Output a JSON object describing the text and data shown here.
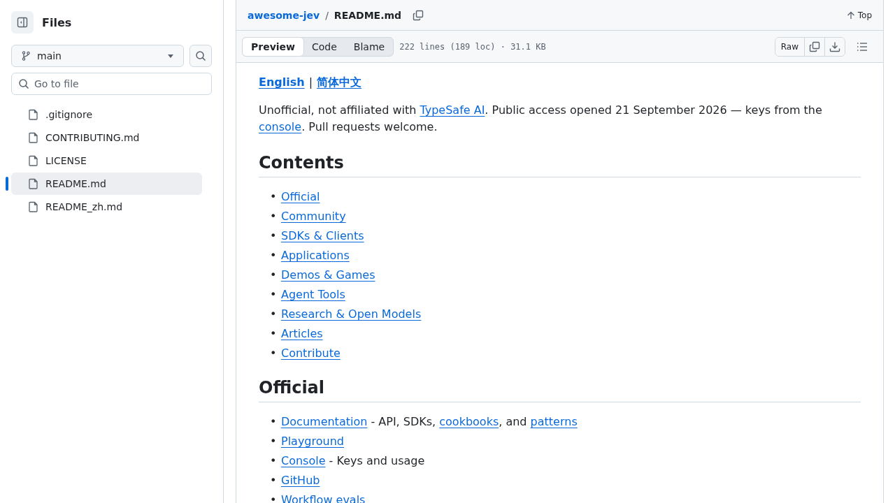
{
  "sidebar": {
    "title": "Files",
    "branch": "main",
    "search": {
      "placeholder": "Go to file"
    },
    "files": [
      {
        "name": ".gitignore",
        "selected": false
      },
      {
        "name": "CONTRIBUTING.md",
        "selected": false
      },
      {
        "name": "LICENSE",
        "selected": false
      },
      {
        "name": "README.md",
        "selected": true
      },
      {
        "name": "README_zh.md",
        "selected": false
      }
    ]
  },
  "breadcrumb": {
    "repo": "awesome-jev",
    "separator": "/",
    "file": "README.md",
    "top": "Top"
  },
  "toolbar": {
    "tabs": [
      {
        "label": "Preview",
        "selected": true
      },
      {
        "label": "Code",
        "selected": false
      },
      {
        "label": "Blame",
        "selected": false
      }
    ],
    "info": "222 lines (189 loc) · 31.1 KB",
    "raw": "Raw"
  },
  "readme": {
    "languages": [
      {
        "text": "English",
        "kind": "link"
      },
      {
        "text": "|",
        "kind": "separator"
      },
      {
        "text": "简体中文",
        "kind": "link"
      }
    ],
    "intro": [
      {
        "text": "Unofficial, not affiliated with ",
        "kind": "text"
      },
      {
        "text": "TypeSafe AI",
        "kind": "link"
      },
      {
        "text": ". Public access opened 21 September 2026 — keys from the ",
        "kind": "text"
      },
      {
        "text": "console",
        "kind": "link"
      },
      {
        "text": ". Pull requests welcome.",
        "kind": "text"
      }
    ],
    "sections": [
      {
        "heading": "Contents",
        "items": [
          {
            "bullet": "•",
            "parts": [
              {
                "text": "Official",
                "kind": "link"
              }
            ]
          },
          {
            "bullet": "•",
            "parts": [
              {
                "text": "Community",
                "kind": "link"
              }
            ]
          },
          {
            "bullet": "•",
            "parts": [
              {
                "text": "SDKs & Clients",
                "kind": "link"
              }
            ]
          },
          {
            "bullet": "•",
            "parts": [
              {
                "text": "Applications",
                "kind": "link"
              }
            ]
          },
          {
            "bullet": "•",
            "parts": [
              {
                "text": "Demos & Games",
                "kind": "link"
              }
            ]
          },
          {
            "bullet": "•",
            "parts": [
              {
                "text": "Agent Tools",
                "kind": "link"
              }
            ]
          },
          {
            "bullet": "•",
            "parts": [
              {
                "text": "Research & Open Models",
                "kind": "link"
              }
            ]
          },
          {
            "bullet": "•",
            "parts": [
              {
                "text": "Articles",
                "kind": "link"
              }
            ]
          },
          {
            "bullet": "•",
            "parts": [
              {
                "text": "Contribute",
                "kind": "link"
              }
            ]
          }
        ]
      },
      {
        "heading": "Official",
        "items": [
          {
            "bullet": "•",
            "parts": [
              {
                "text": "Documentation",
                "kind": "link"
              },
              {
                "text": " - API, SDKs, ",
                "kind": "text"
              },
              {
                "text": "cookbooks",
                "kind": "link"
              },
              {
                "text": ", and ",
                "kind": "text"
              },
              {
                "text": "patterns",
                "kind": "link"
              }
            ]
          },
          {
            "bullet": "•",
            "parts": [
              {
                "text": "Playground",
                "kind": "link"
              }
            ]
          },
          {
            "bullet": "•",
            "parts": [
              {
                "text": "Console",
                "kind": "link"
              },
              {
                "text": " - Keys and usage",
                "kind": "text"
              }
            ]
          },
          {
            "bullet": "•",
            "parts": [
              {
                "text": "GitHub",
                "kind": "link"
              }
            ]
          },
          {
            "bullet": "•",
            "parts": [
              {
                "text": "Workflow evals",
                "kind": "link"
              }
            ]
          }
        ]
      }
    ]
  }
}
